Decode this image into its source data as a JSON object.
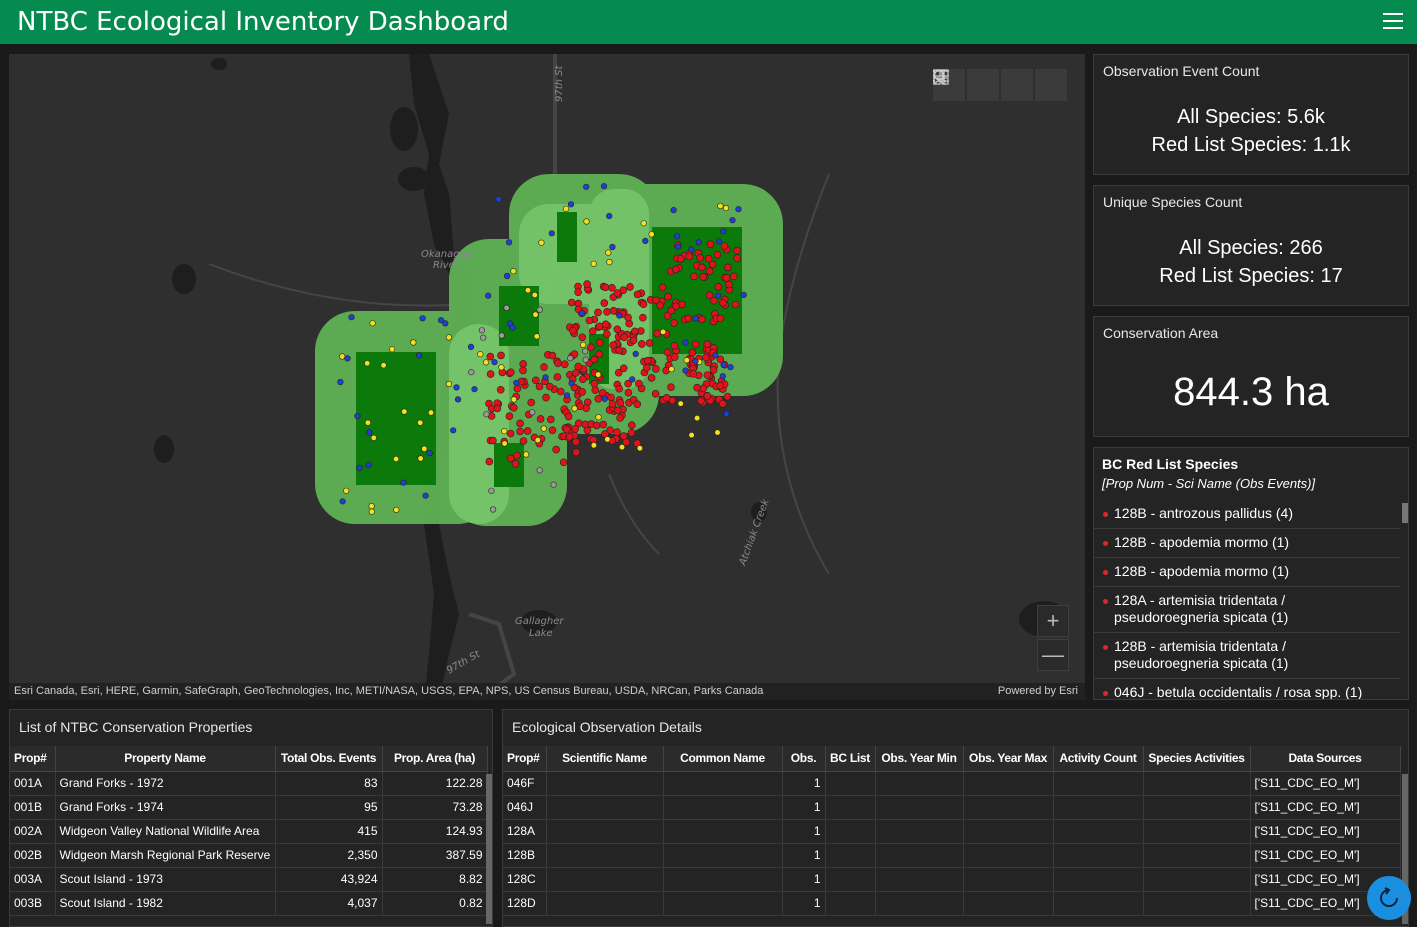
{
  "header": {
    "title": "NTBC Ecological Inventory Dashboard",
    "menu_icon": "hamburger-menu-icon"
  },
  "map": {
    "toolbar": [
      "search-icon",
      "bookmark-icon",
      "legend-list-icon",
      "basemap-gallery-icon"
    ],
    "labels": {
      "street_97_top": "97th St",
      "okanagan_1": "Okanagan",
      "okanagan_2": "River",
      "street_97_mid": "97th St",
      "atchiak": "Atchiak Creek",
      "gallagher_1": "Gallagher",
      "gallagher_2": "Lake",
      "street_97_bottom": "97th St"
    },
    "zoom_in": "+",
    "zoom_out": "—",
    "attribution": "Esri Canada, Esri, HERE, Garmin, SafeGraph, GeoTechnologies, Inc, METI/NASA, USGS, EPA, NPS, US Census Bureau, USDA, NRCan, Parks Canada",
    "powered_by": "Powered by Esri",
    "colors": {
      "buffer": "#5fb254",
      "property": "#0b7a0b",
      "red_list": "#e0131b",
      "blue": "#1f3fd6",
      "yellow": "#f2e01c"
    }
  },
  "obs_count": {
    "title": "Observation Event Count",
    "all": "All Species: 5.6k",
    "red": "Red List Species: 1.1k"
  },
  "species_count": {
    "title": "Unique Species Count",
    "all": "All Species: 266",
    "red": "Red List Species: 17"
  },
  "cons_area": {
    "title": "Conservation Area",
    "value": "844.3 ha"
  },
  "red_list": {
    "title": "BC Red List Species",
    "subtitle": "[Prop Num - Sci Name (Obs Events)]",
    "items": [
      "128B - antrozous pallidus (4)",
      "128B - apodemia mormo (1)",
      "128B - apodemia mormo (1)",
      "128A - artemisia tridentata / pseudoroegneria spicata (1)",
      "128B - artemisia tridentata / pseudoroegneria spicata (1)",
      "046J - betula occidentalis / rosa spp. (1)"
    ]
  },
  "properties": {
    "title": "List of NTBC Conservation Properties",
    "columns": [
      "Prop#",
      "Property Name",
      "Total Obs. Events",
      "Prop. Area (ha)"
    ],
    "rows": [
      [
        "001A",
        "Grand Forks - 1972",
        "83",
        "122.28"
      ],
      [
        "001B",
        "Grand Forks - 1974",
        "95",
        "73.28"
      ],
      [
        "002A",
        "Widgeon Valley National Wildlife Area",
        "415",
        "124.93"
      ],
      [
        "002B",
        "Widgeon Marsh Regional Park Reserve",
        "2,350",
        "387.59"
      ],
      [
        "003A",
        "Scout Island - 1973",
        "43,924",
        "8.82"
      ],
      [
        "003B",
        "Scout Island - 1982",
        "4,037",
        "0.82"
      ]
    ]
  },
  "observations": {
    "title": "Ecological Observation Details",
    "columns": [
      "Prop#",
      "Scientific Name",
      "Common Name",
      "Obs.",
      "BC List",
      "Obs. Year Min",
      "Obs. Year Max",
      "Activity Count",
      "Species Activities",
      "Data Sources"
    ],
    "rows": [
      [
        "046F",
        "",
        "",
        "1",
        "",
        "",
        "",
        "",
        "",
        "['S11_CDC_EO_M']"
      ],
      [
        "046J",
        "",
        "",
        "1",
        "",
        "",
        "",
        "",
        "",
        "['S11_CDC_EO_M']"
      ],
      [
        "128A",
        "",
        "",
        "1",
        "",
        "",
        "",
        "",
        "",
        "['S11_CDC_EO_M']"
      ],
      [
        "128B",
        "",
        "",
        "1",
        "",
        "",
        "",
        "",
        "",
        "['S11_CDC_EO_M']"
      ],
      [
        "128C",
        "",
        "",
        "1",
        "",
        "",
        "",
        "",
        "",
        "['S11_CDC_EO_M']"
      ],
      [
        "128D",
        "",
        "",
        "1",
        "",
        "",
        "",
        "",
        "",
        "['S11_CDC_EO_M']"
      ]
    ]
  }
}
